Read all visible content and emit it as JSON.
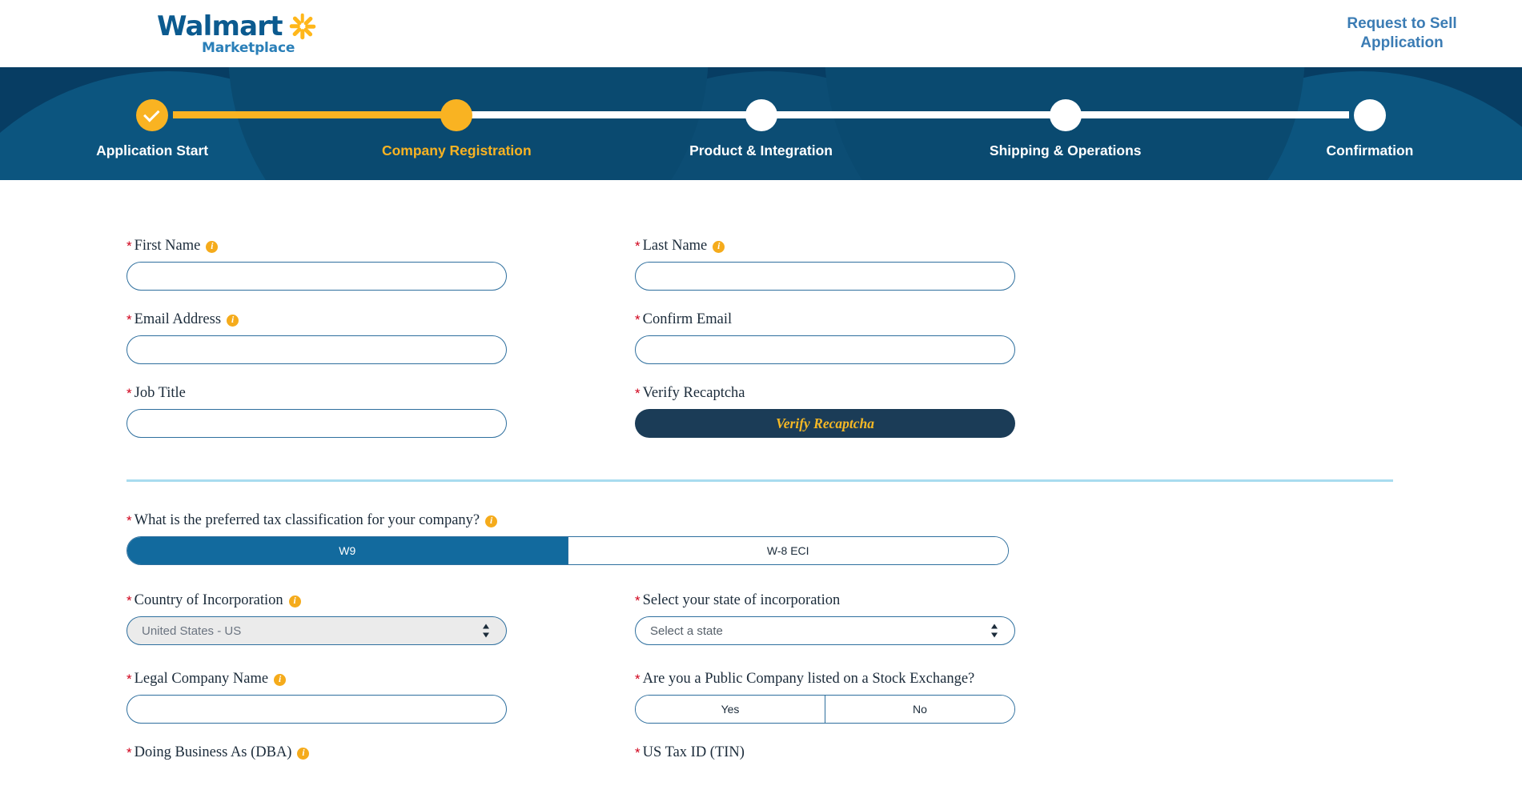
{
  "header": {
    "logo_word": "Walmart",
    "logo_sub": "Marketplace",
    "spark_icon": "walmart-spark-icon",
    "link_line1": "Request to Sell",
    "link_line2": "Application"
  },
  "stepper": {
    "steps": [
      {
        "label": "Application Start",
        "state": "done"
      },
      {
        "label": "Company Registration",
        "state": "active"
      },
      {
        "label": "Product & Integration",
        "state": "todo"
      },
      {
        "label": "Shipping & Operations",
        "state": "todo"
      },
      {
        "label": "Confirmation",
        "state": "todo"
      }
    ],
    "progress_percent": 25,
    "accent_color": "#f9b322",
    "banner_color": "#073d63",
    "track_color": "#ffffff"
  },
  "form": {
    "first_name": {
      "label": "First Name",
      "value": "",
      "placeholder": ""
    },
    "last_name": {
      "label": "Last Name",
      "value": "",
      "placeholder": ""
    },
    "email": {
      "label": "Email Address",
      "value": "",
      "placeholder": ""
    },
    "confirm_email": {
      "label": "Confirm Email",
      "value": "",
      "placeholder": ""
    },
    "job_title": {
      "label": "Job Title",
      "value": "",
      "placeholder": ""
    },
    "recaptcha": {
      "label": "Verify Recaptcha",
      "button_label": "Verify Recaptcha"
    },
    "tax_classification": {
      "label": "What is the preferred tax classification for your company?",
      "options": [
        "W9",
        "W-8 ECI"
      ],
      "selected": "W9"
    },
    "country": {
      "label": "Country of Incorporation",
      "value": "United States - US",
      "disabled": true
    },
    "state": {
      "label": "Select your state of incorporation",
      "value": "Select a state"
    },
    "public_company": {
      "label": "Are you a Public Company listed on a Stock Exchange?",
      "options": [
        "Yes",
        "No"
      ],
      "selected": ""
    },
    "legal_company_name": {
      "label": "Legal Company Name",
      "value": ""
    },
    "dba": {
      "label": "Doing Business As (DBA)",
      "value": ""
    },
    "tin": {
      "label": "US Tax ID (TIN)",
      "value": ""
    },
    "required_marker": "*",
    "info_icon_glyph": "i"
  }
}
